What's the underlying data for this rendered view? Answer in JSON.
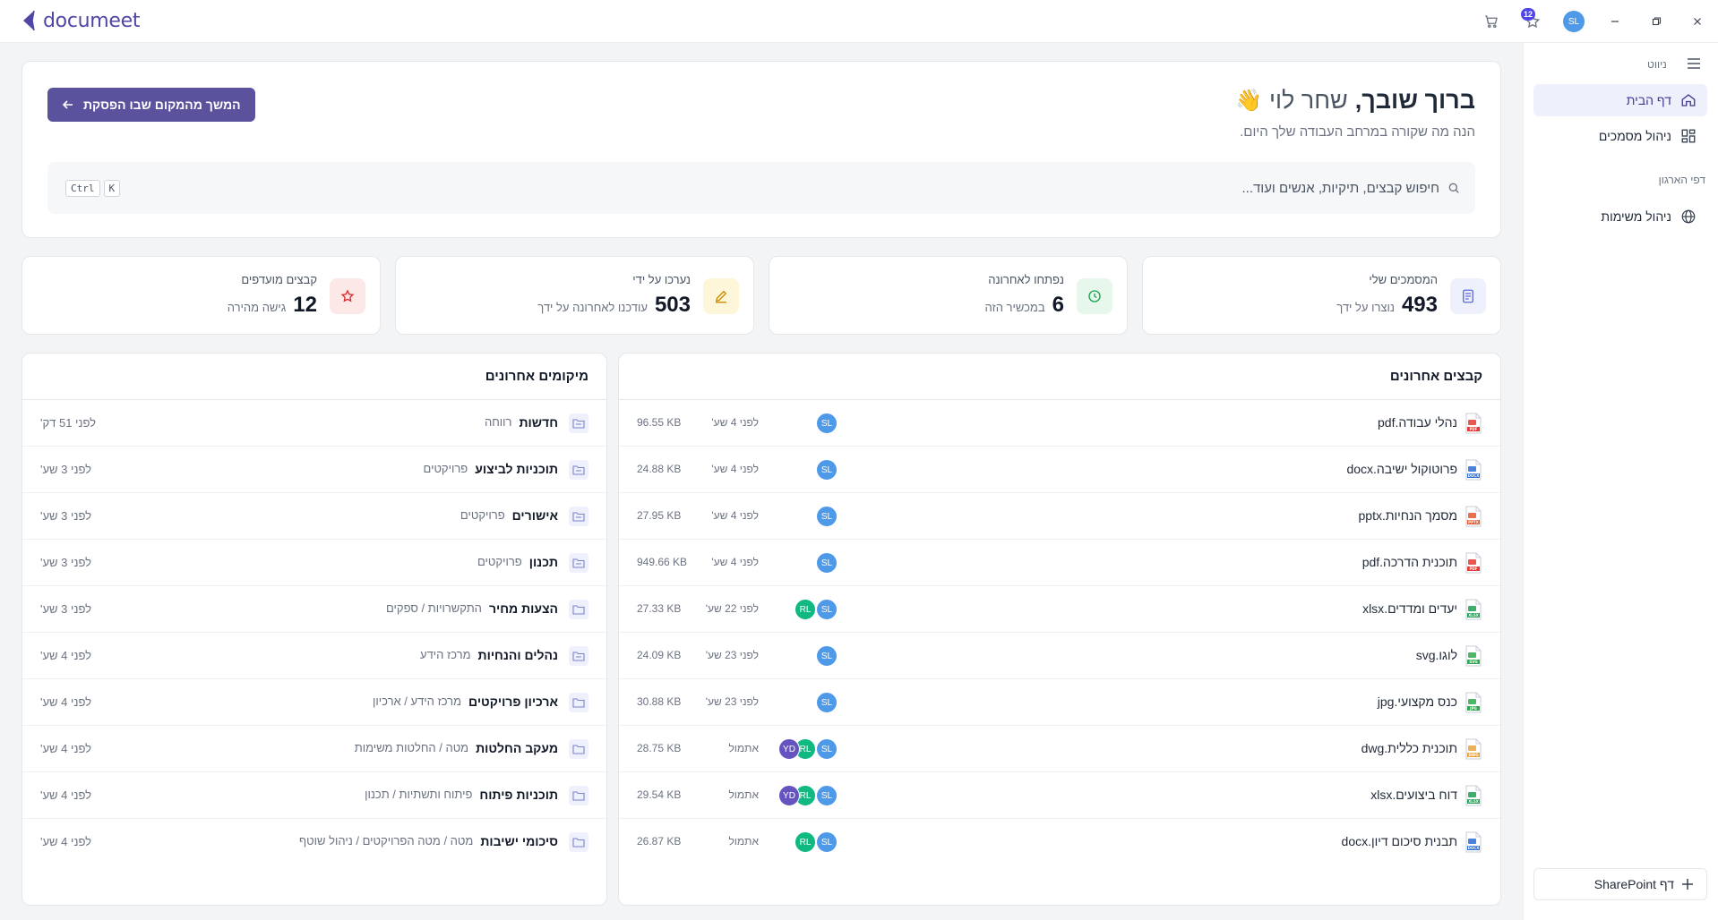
{
  "app": {
    "logo_text": "documeet",
    "brand_color": "#5a529c"
  },
  "topbar": {
    "favorites_badge": "12",
    "user_initials": "SL"
  },
  "sidebar": {
    "header_label": "ניווט",
    "items": [
      {
        "label": "דף הבית",
        "icon": "home-icon",
        "active": true
      },
      {
        "label": "ניהול מסמכים",
        "icon": "grid-icon",
        "active": false
      }
    ],
    "section_label": "דפי הארגון",
    "org_items": [
      {
        "label": "ניהול משימות",
        "icon": "globe-icon"
      }
    ],
    "add_button": "דף SharePoint"
  },
  "welcome": {
    "greeting": "ברוך שובך,",
    "name": "שחר לוי",
    "emoji": "👋",
    "subtitle": "הנה מה שקורה במרחב העבודה שלך היום.",
    "continue_button": "המשך מהמקום שבו הפסקת",
    "search_placeholder": "חיפוש קבצים, תיקיות, אנשים ועוד...",
    "shortcut_key1": "Ctrl",
    "shortcut_key2": "K"
  },
  "stats": [
    {
      "label": "המסמכים שלי",
      "value": "493",
      "desc": "נוצרו על ידך",
      "icon": "document-icon",
      "color": "#5b6bd5",
      "bg": "#eef0fb"
    },
    {
      "label": "נפתחו לאחרונה",
      "value": "6",
      "desc": "במכשיר הזה",
      "icon": "clock-icon",
      "color": "#16a34a",
      "bg": "#e7f7ec"
    },
    {
      "label": "נערכו על ידי",
      "value": "503",
      "desc": "עודכנו לאחרונה על ידך",
      "icon": "pencil-icon",
      "color": "#ca8a04",
      "bg": "#fdf6d8"
    },
    {
      "label": "קבצים מועדפים",
      "value": "12",
      "desc": "גישה מהירה",
      "icon": "star-icon",
      "color": "#dc2626",
      "bg": "#fde8e8"
    }
  ],
  "recent_files": {
    "title": "קבצים אחרונים",
    "rows": [
      {
        "name": "נהלי עבודה.pdf",
        "type": "pdf",
        "avatars": [
          "SL"
        ],
        "time": "לפני 4 שע'",
        "size": "96.55 KB"
      },
      {
        "name": "פרוטוקול ישיבה.docx",
        "type": "docx",
        "avatars": [
          "SL"
        ],
        "time": "לפני 4 שע'",
        "size": "24.88 KB"
      },
      {
        "name": "מסמך הנחיות.pptx",
        "type": "pptx",
        "avatars": [
          "SL"
        ],
        "time": "לפני 4 שע'",
        "size": "27.95 KB"
      },
      {
        "name": "תוכנית הדרכה.pdf",
        "type": "pdf",
        "avatars": [
          "SL"
        ],
        "time": "לפני 4 שע'",
        "size": "949.66 KB"
      },
      {
        "name": "יעדים ומדדים.xlsx",
        "type": "xlsx",
        "avatars": [
          "SL",
          "RL"
        ],
        "time": "לפני 22 שע'",
        "size": "27.33 KB"
      },
      {
        "name": "לוגו.svg",
        "type": "svg",
        "avatars": [
          "SL"
        ],
        "time": "לפני 23 שע'",
        "size": "24.09 KB"
      },
      {
        "name": "כנס מקצועי.jpg",
        "type": "jpg",
        "avatars": [
          "SL"
        ],
        "time": "לפני 23 שע'",
        "size": "30.88 KB"
      },
      {
        "name": "תוכנית כללית.dwg",
        "type": "dwg",
        "avatars": [
          "SL",
          "RL",
          "YD"
        ],
        "time": "אתמול",
        "size": "28.75 KB"
      },
      {
        "name": "דוח ביצועים.xlsx",
        "type": "xlsx",
        "avatars": [
          "SL",
          "RL",
          "YD"
        ],
        "time": "אתמול",
        "size": "29.54 KB"
      },
      {
        "name": "תבנית סיכום דיון.docx",
        "type": "docx",
        "avatars": [
          "SL",
          "RL"
        ],
        "time": "אתמול",
        "size": "26.87 KB"
      }
    ]
  },
  "recent_places": {
    "title": "מיקומים אחרונים",
    "rows": [
      {
        "name": "חדשות",
        "path": "רווחה",
        "time": "לפני 51 דק'",
        "kind": "library"
      },
      {
        "name": "תוכניות לביצוע",
        "path": "פרויקטים",
        "time": "לפני 3 שע'",
        "kind": "library"
      },
      {
        "name": "אישורים",
        "path": "פרויקטים",
        "time": "לפני 3 שע'",
        "kind": "library"
      },
      {
        "name": "תכנון",
        "path": "פרויקטים",
        "time": "לפני 3 שע'",
        "kind": "library"
      },
      {
        "name": "הצעות מחיר",
        "path": "התקשרויות / ספקים",
        "time": "לפני 3 שע'",
        "kind": "folder"
      },
      {
        "name": "נהלים והנחיות",
        "path": "מרכז הידע",
        "time": "לפני 4 שע'",
        "kind": "library"
      },
      {
        "name": "ארכיון פרויקטים",
        "path": "מרכז הידע / ארכיון",
        "time": "לפני 4 שע'",
        "kind": "folder"
      },
      {
        "name": "מעקב החלטות",
        "path": "מטה / החלטות משימות",
        "time": "לפני 4 שע'",
        "kind": "folder"
      },
      {
        "name": "תוכניות פיתוח",
        "path": "פיתוח ותשתיות / תכנון",
        "time": "לפני 4 שע'",
        "kind": "folder"
      },
      {
        "name": "סיכומי ישיבות",
        "path": "מטה / מטה הפרויקטים / ניהול שוטף",
        "time": "לפני 4 שע'",
        "kind": "folder"
      }
    ]
  },
  "file_type_colors": {
    "pdf": "#e53935",
    "docx": "#2b6cd6",
    "pptx": "#e5572e",
    "xlsx": "#1f9d55",
    "svg": "#2fa84f",
    "jpg": "#2fa84f",
    "dwg": "#e9a23b"
  }
}
